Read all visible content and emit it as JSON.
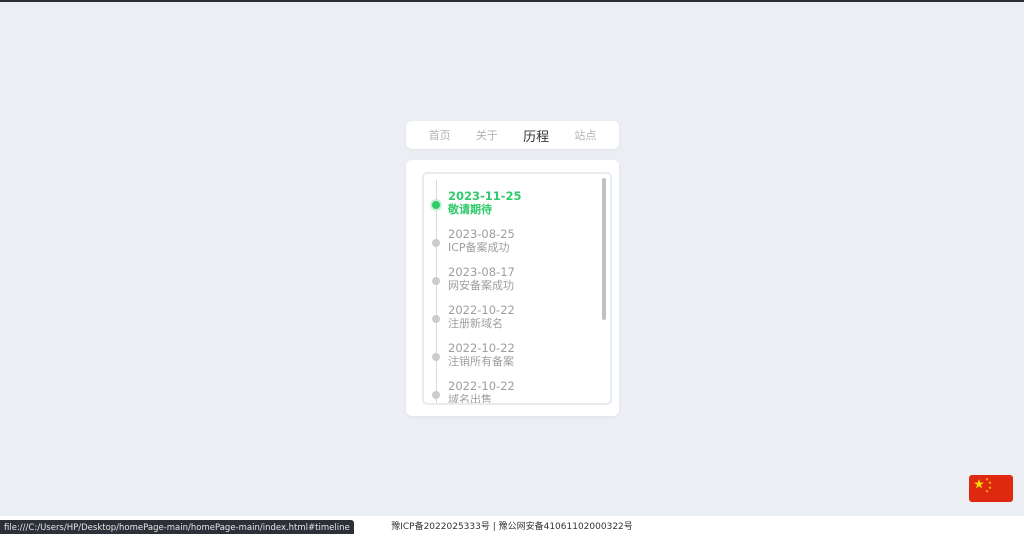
{
  "nav": {
    "items": [
      {
        "label": "首页"
      },
      {
        "label": "关于"
      },
      {
        "label": "历程"
      },
      {
        "label": "站点"
      }
    ],
    "active_index": 2
  },
  "timeline": {
    "items": [
      {
        "date": "2023-11-25",
        "text": "敬请期待",
        "active": true
      },
      {
        "date": "2023-08-25",
        "text": "ICP备案成功",
        "active": false
      },
      {
        "date": "2023-08-17",
        "text": "网安备案成功",
        "active": false
      },
      {
        "date": "2022-10-22",
        "text": "注册新域名",
        "active": false
      },
      {
        "date": "2022-10-22",
        "text": "注销所有备案",
        "active": false
      },
      {
        "date": "2022-10-22",
        "text": "域名出售",
        "active": false
      }
    ],
    "active_color": "#2fcb6a",
    "inactive_color": "#9e9e9e"
  },
  "footer": {
    "text": "豫ICP备2022025333号 | 豫公网安备41061102000322号"
  },
  "status_bar": {
    "url": "file:///C:/Users/HP/Desktop/homePage-main/homePage-main/index.html#timeline"
  },
  "flag": {
    "icon": "china-flag-icon",
    "color": "#de2910"
  }
}
